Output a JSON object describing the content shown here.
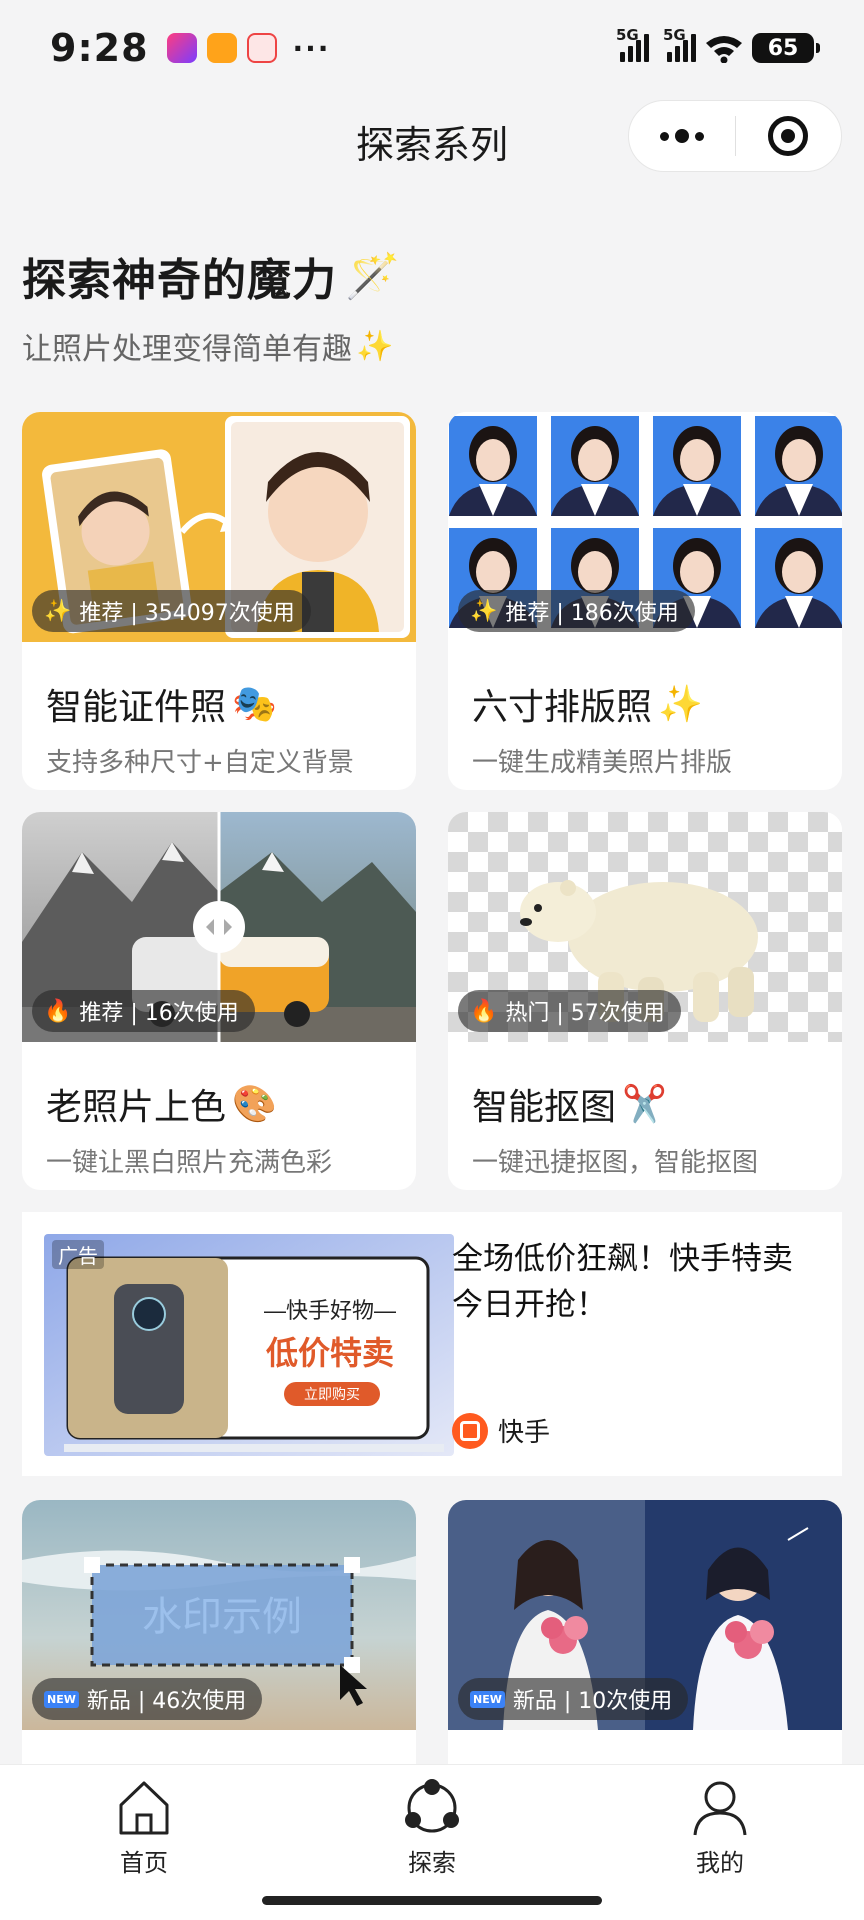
{
  "status_bar": {
    "time": "9:28",
    "more": "···",
    "signal1_label": "5G",
    "signal2_label": "5G",
    "battery": "65"
  },
  "nav": {
    "title": "探索系列",
    "icons": [
      "more-dots-icon",
      "target-close-icon"
    ]
  },
  "hero": {
    "title": "探索神奇的魔力",
    "title_emoji": "🪄",
    "subtitle": "让照片处理变得简单有趣",
    "subtitle_emoji": "✨"
  },
  "cards": [
    {
      "title": "智能证件照",
      "emoji": "🎭",
      "desc": "支持多种尺寸+自定义背景",
      "badge_icon": "✨",
      "badge": "推荐 | 354097次使用"
    },
    {
      "title": "六寸排版照",
      "emoji": "✨",
      "desc": "一键生成精美照片排版",
      "badge_icon": "✨",
      "badge": "推荐 | 186次使用"
    },
    {
      "title": "老照片上色",
      "emoji": "🎨",
      "desc": "一键让黑白照片充满色彩",
      "badge_icon": "🔥",
      "badge": "推荐 | 16次使用"
    },
    {
      "title": "智能抠图",
      "emoji": "✂️",
      "desc": "一键迅捷抠图，智能抠图",
      "badge_icon": "🔥",
      "badge": "热门 | 57次使用"
    },
    {
      "title": "",
      "emoji": "",
      "desc": "",
      "badge_icon": "NEW",
      "badge": "新品 | 46次使用",
      "image_text": "水印示例"
    },
    {
      "title": "",
      "emoji": "",
      "desc": "",
      "badge_icon": "NEW",
      "badge": "新品 | 10次使用"
    }
  ],
  "ad": {
    "label": "广告",
    "headline": "全场低价狂飙！快手特卖今日开抢！",
    "brand": "快手",
    "image_brand": "—快手好物—",
    "image_title": "低价特卖",
    "image_button": "立即购买"
  },
  "tabs": [
    {
      "label": "首页",
      "icon": "home-icon"
    },
    {
      "label": "探索",
      "icon": "explore-icon"
    },
    {
      "label": "我的",
      "icon": "profile-icon"
    }
  ],
  "colors": {
    "accent_orange": "#ff5a1f",
    "id_blue": "#3b82e8",
    "card_yellow": "#f3b93c"
  }
}
